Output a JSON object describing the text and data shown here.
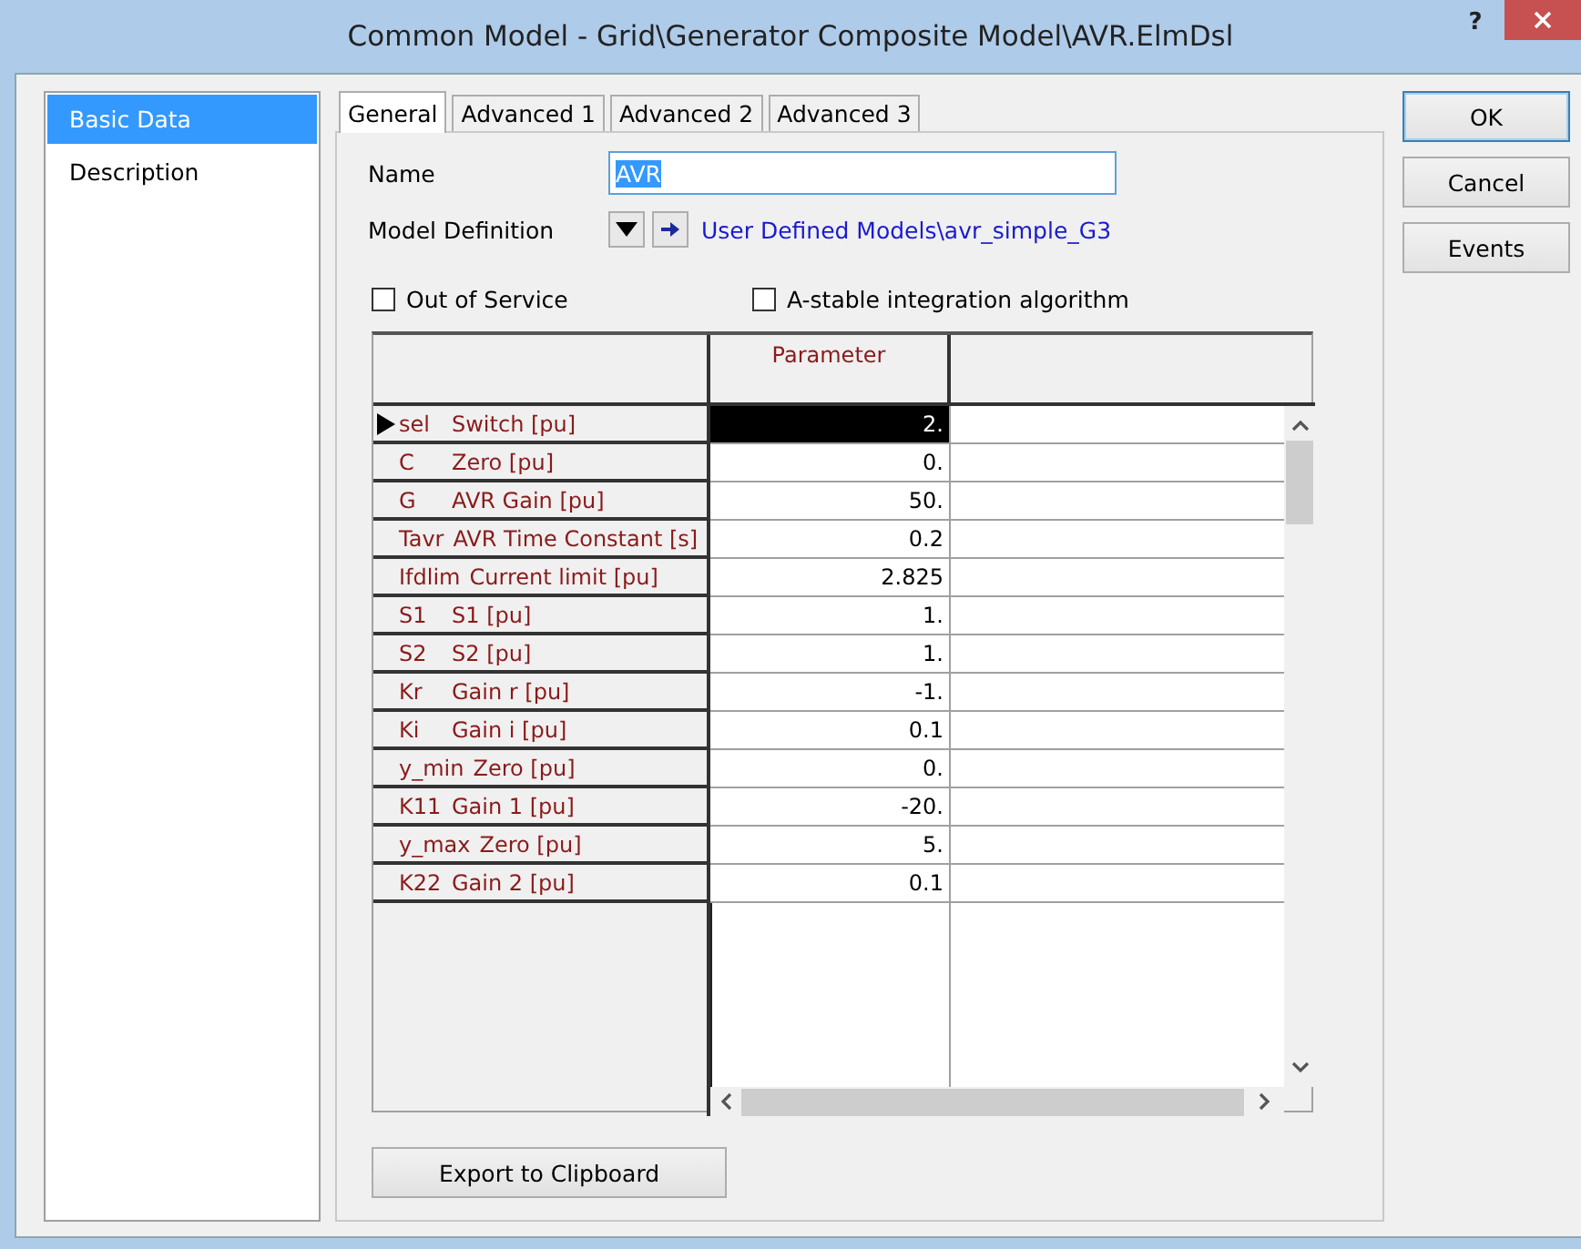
{
  "window": {
    "title": "Common Model - Grid\\Generator Composite Model\\AVR.ElmDsl",
    "help_button": "?"
  },
  "sidebar": {
    "items": [
      {
        "label": "Basic Data",
        "selected": true
      },
      {
        "label": "Description",
        "selected": false
      }
    ]
  },
  "tabs": [
    {
      "label": "General",
      "selected": true
    },
    {
      "label": "Advanced 1",
      "selected": false
    },
    {
      "label": "Advanced 2",
      "selected": false
    },
    {
      "label": "Advanced 3",
      "selected": false
    }
  ],
  "name": {
    "label": "Name",
    "value": "AVR",
    "value_selected": true
  },
  "model_definition": {
    "label": "Model Definition",
    "link": "User Defined Models\\avr_simple_G3"
  },
  "checkboxes": [
    {
      "label": "Out of Service",
      "checked": false
    },
    {
      "label": "A-stable integration algorithm",
      "checked": false
    }
  ],
  "table": {
    "columns": [
      "Parameter"
    ],
    "rows": [
      {
        "symbol": "sel",
        "description": "Switch [pu]",
        "value": "2.",
        "selected": true
      },
      {
        "symbol": "C",
        "description": "Zero [pu]",
        "value": "0.",
        "selected": false
      },
      {
        "symbol": "G",
        "description": "AVR Gain [pu]",
        "value": "50.",
        "selected": false
      },
      {
        "symbol": "Tavr",
        "description": "AVR Time Constant [s]",
        "value": "0.2",
        "selected": false
      },
      {
        "symbol": "Ifdlim",
        "description": "Current limit [pu]",
        "value": "2.825",
        "selected": false
      },
      {
        "symbol": "S1",
        "description": "S1 [pu]",
        "value": "1.",
        "selected": false
      },
      {
        "symbol": "S2",
        "description": "S2 [pu]",
        "value": "1.",
        "selected": false
      },
      {
        "symbol": "Kr",
        "description": "Gain r [pu]",
        "value": "-1.",
        "selected": false
      },
      {
        "symbol": "Ki",
        "description": "Gain i [pu]",
        "value": "0.1",
        "selected": false
      },
      {
        "symbol": "y_min",
        "description": "Zero [pu]",
        "value": "0.",
        "selected": false
      },
      {
        "symbol": "K11",
        "description": "Gain 1 [pu]",
        "value": "-20.",
        "selected": false
      },
      {
        "symbol": "y_max",
        "description": "Zero [pu]",
        "value": "5.",
        "selected": false
      },
      {
        "symbol": "K22",
        "description": "Gain 2 [pu]",
        "value": "0.1",
        "selected": false
      }
    ]
  },
  "export_button": "Export to Clipboard",
  "buttons": [
    {
      "label": "OK",
      "default": true
    },
    {
      "label": "Cancel",
      "default": false
    },
    {
      "label": "Events",
      "default": false
    }
  ]
}
